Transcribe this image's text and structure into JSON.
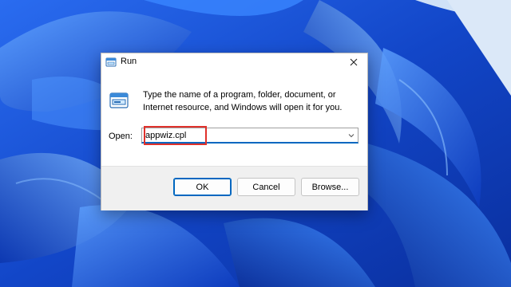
{
  "dialog": {
    "title": "Run",
    "description_line1": "Type the name of a program, folder, document, or",
    "description_line2": "Internet resource, and Windows will open it for you.",
    "open_label": "Open:",
    "open_value": "appwiz.cpl",
    "buttons": {
      "ok": "OK",
      "cancel": "Cancel",
      "browse": "Browse..."
    }
  },
  "icons": {
    "title": "run-icon",
    "close": "close-icon",
    "dropdown": "chevron-down-icon"
  },
  "colors": {
    "accent": "#0067c0",
    "highlight": "#e0312b",
    "wallpaper": "#1a4fd0"
  }
}
